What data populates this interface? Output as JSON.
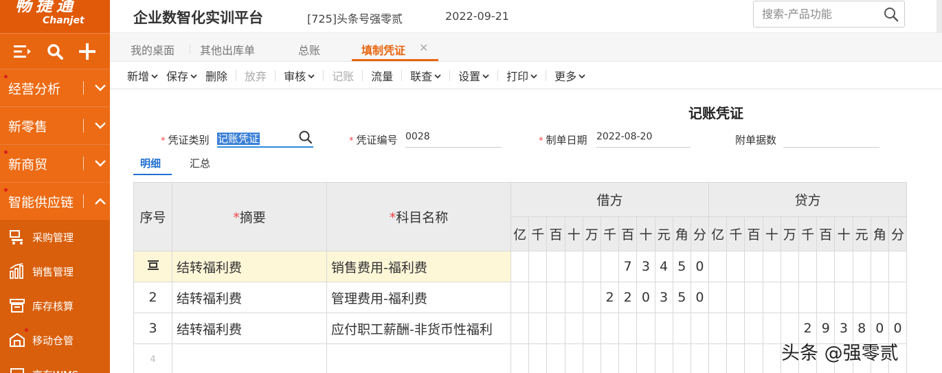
{
  "sidebar": {
    "logo_cn": "畅捷通",
    "logo_en": "Chanjet",
    "tools": [
      "menu-icon",
      "search-icon",
      "plus-icon"
    ],
    "nav": [
      {
        "label": "经营分析",
        "expanded": false,
        "dot": true
      },
      {
        "label": "新零售",
        "expanded": false,
        "dot": false
      },
      {
        "label": "新商贸",
        "expanded": false,
        "dot": true
      },
      {
        "label": "智能供应链",
        "expanded": true,
        "dot": true
      }
    ],
    "sub": [
      {
        "label": "采购管理",
        "icon": "purchase-icon"
      },
      {
        "label": "销售管理",
        "icon": "sales-chart-icon"
      },
      {
        "label": "库存核算",
        "icon": "inventory-icon"
      },
      {
        "label": "移动仓管",
        "icon": "mobile-warehouse-icon"
      },
      {
        "label": "京东WMS",
        "icon": "wms-icon"
      }
    ]
  },
  "header": {
    "title": "企业数智化实训平台",
    "account": "[725]头条号强零贰",
    "date": "2022-09-21",
    "search_placeholder": "搜索-产品功能"
  },
  "tabs": [
    {
      "label": "我的桌面",
      "active": false
    },
    {
      "label": "其他出库单",
      "active": false
    },
    {
      "label": "总账",
      "active": false
    },
    {
      "label": "填制凭证",
      "active": true
    }
  ],
  "toolbar": [
    {
      "label": "新增",
      "caret": true,
      "disabled": false
    },
    {
      "label": "保存",
      "caret": true,
      "disabled": false
    },
    {
      "label": "删除",
      "caret": false,
      "disabled": false
    },
    {
      "label": "放弃",
      "caret": false,
      "disabled": true
    },
    {
      "label": "审核",
      "caret": true,
      "disabled": false
    },
    {
      "label": "记账",
      "caret": false,
      "disabled": true
    },
    {
      "label": "流量",
      "caret": false,
      "disabled": false
    },
    {
      "label": "联查",
      "caret": true,
      "disabled": false
    },
    {
      "label": "设置",
      "caret": true,
      "disabled": false
    },
    {
      "label": "打印",
      "caret": true,
      "disabled": false
    },
    {
      "label": "更多",
      "caret": true,
      "disabled": false
    }
  ],
  "voucher": {
    "title": "记账凭证",
    "fields": {
      "type_label": "凭证类别",
      "type_value": "记账凭证",
      "number_label": "凭证编号",
      "number_value": "0028",
      "date_label": "制单日期",
      "date_value": "2022-08-20",
      "attach_label": "附单据数",
      "attach_value": ""
    },
    "subtabs": [
      "明细",
      "汇总"
    ],
    "table": {
      "col_index": "序号",
      "col_summary": "摘要",
      "col_account": "科目名称",
      "col_debit": "借方",
      "col_credit": "贷方",
      "digit_units": [
        "亿",
        "千",
        "百",
        "十",
        "万",
        "千",
        "百",
        "十",
        "元",
        "角",
        "分"
      ],
      "rows": [
        {
          "index": "",
          "index_icon": "row-edit-icon",
          "summary": "结转福利费",
          "account": "销售费用-福利费",
          "debit": "73450",
          "credit": ""
        },
        {
          "index": "2",
          "summary": "结转福利费",
          "account": "管理费用-福利费",
          "debit": "220350",
          "credit": ""
        },
        {
          "index": "3",
          "summary": "结转福利费",
          "account": "应付职工薪酬-非货币性福利",
          "debit": "",
          "credit": "293800"
        },
        {
          "index": "4",
          "summary": "",
          "account": "",
          "debit": "",
          "credit": ""
        }
      ]
    }
  },
  "watermark": "头条 @强零贰"
}
